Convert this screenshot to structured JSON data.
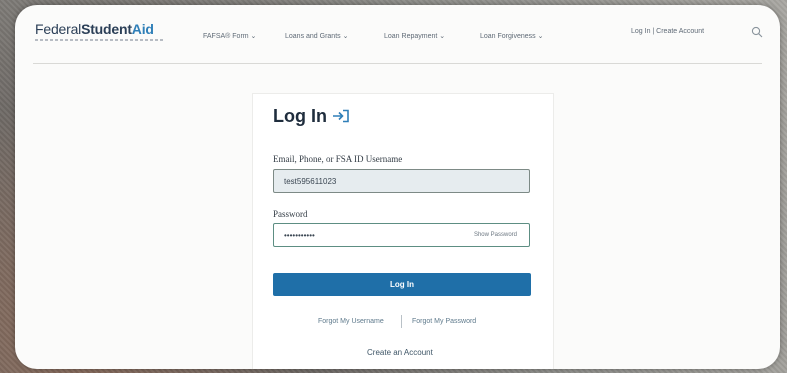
{
  "header": {
    "logo": {
      "part1": "Federal",
      "part2": "Student",
      "part3": "Aid"
    },
    "nav": [
      "FAFSA® Form ⌄",
      "Loans and Grants ⌄",
      "Loan Repayment ⌄",
      "Loan Forgiveness ⌄"
    ],
    "account_links": "Log In | Create Account",
    "search_icon": "search-icon"
  },
  "login": {
    "title": "Log In",
    "title_icon": "login-arrow-icon",
    "username_label": "Email, Phone, or FSA ID Username",
    "username_value": "test595611023",
    "password_label": "Password",
    "password_value": "•••••••••••",
    "show_password": "Show Password",
    "submit_label": "Log In",
    "forgot_username": "Forgot My Username",
    "forgot_password": "Forgot My Password",
    "create_account": "Create an Account"
  },
  "colors": {
    "brand": "#2b3f57",
    "accent": "#2f7fb8",
    "button": "#1f6fa8"
  }
}
